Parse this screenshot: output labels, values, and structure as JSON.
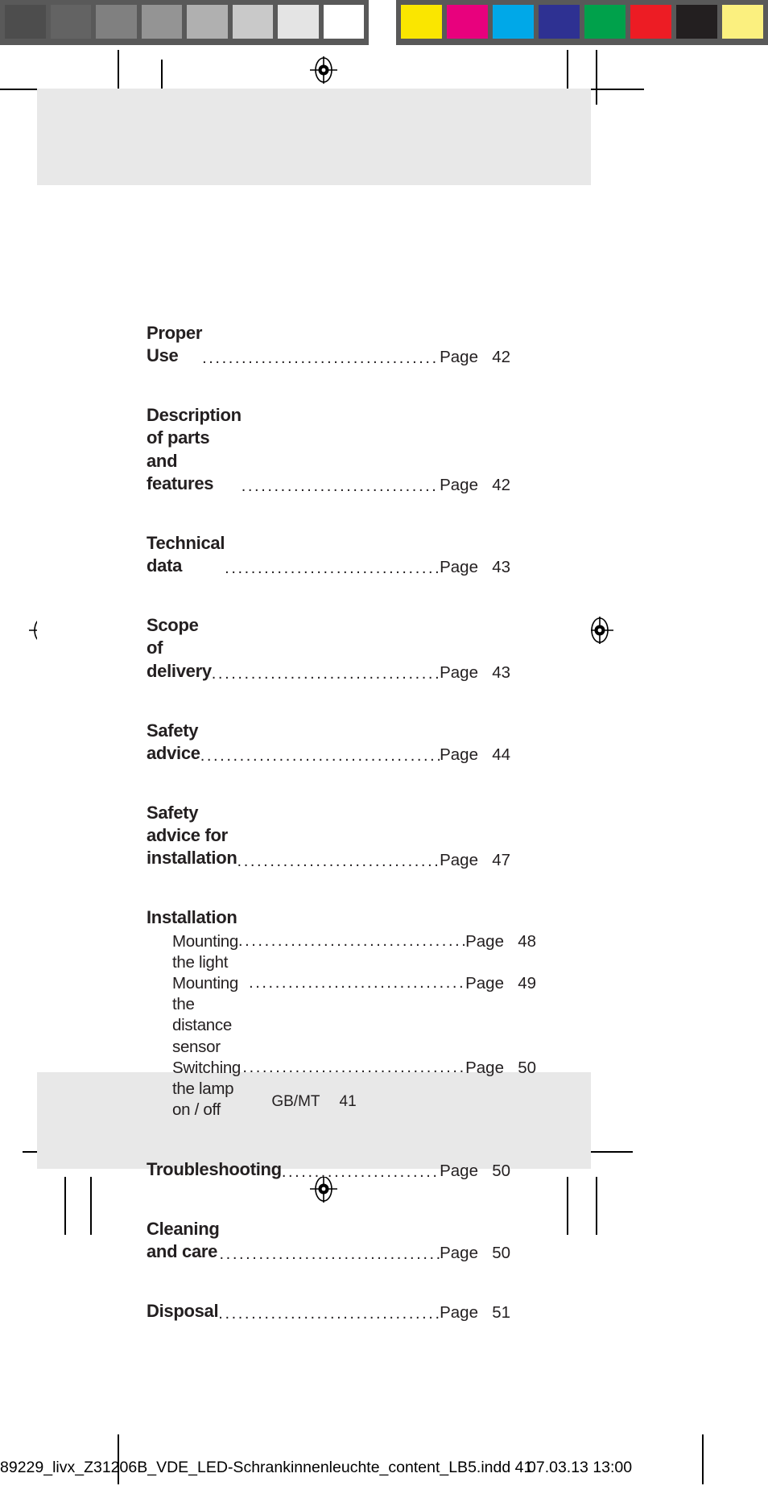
{
  "prepress": {
    "greyscale_strip": {
      "name": "greyscale-control-strip",
      "patches": [
        "#4d4d4d",
        "#636363",
        "#808080",
        "#949494",
        "#b0b0b0",
        "#c9c9c9",
        "#e4e4e4",
        "#ffffff"
      ]
    },
    "color_strip": {
      "name": "color-control-strip",
      "patches": [
        "#fae600",
        "#e8017d",
        "#00a8e8",
        "#2e3192",
        "#00a14b",
        "#ed1c24",
        "#231f20",
        "#fbf07f"
      ]
    },
    "strip_background": "#595959",
    "registration_marks": 3,
    "slug_line": {
      "filename": "89229_livx_Z31206B_VDE_LED-Schrankinnenleuchte_content_LB5.indd   41",
      "timestamp": "07.03.13   13:00"
    }
  },
  "page": {
    "background": "#ffffff",
    "band_color": "#e8e8e8",
    "footer": {
      "locale": "GB/MT",
      "folio": "41"
    }
  },
  "toc": {
    "page_label": "Page",
    "entries": [
      {
        "title": "Proper Use",
        "leader": true,
        "page_label": "Page",
        "page": "42",
        "level": 1,
        "lines": 1
      },
      {
        "title": "Description of parts and\nfeatures",
        "leader": true,
        "page_label": "Page",
        "page": "42",
        "level": 1,
        "lines": 2
      },
      {
        "title": "Technical data",
        "leader": true,
        "page_label": "Page",
        "page": "43",
        "level": 1,
        "lines": 1
      },
      {
        "title": "Scope of delivery",
        "leader": true,
        "page_label": "Page",
        "page": "43",
        "level": 1,
        "lines": 1
      },
      {
        "title": "Safety advice",
        "leader": true,
        "page_label": "Page",
        "page": "44",
        "level": 1,
        "lines": 1
      },
      {
        "title": "Safety advice for\ninstallation",
        "leader": true,
        "page_label": "Page",
        "page": "47",
        "level": 1,
        "lines": 2
      }
    ],
    "installation_group": {
      "heading": "Installation",
      "items": [
        {
          "title": "Mounting the light",
          "page_label": "Page",
          "page": "48"
        },
        {
          "title": "Mounting the distance sensor",
          "page_label": "Page",
          "page": "49"
        },
        {
          "title": "Switching the lamp on / off",
          "page_label": "Page",
          "page": "50"
        }
      ]
    },
    "entries_after": [
      {
        "title": "Troubleshooting",
        "leader": true,
        "page_label": "Page",
        "page": "50",
        "level": 1,
        "lines": 1
      },
      {
        "title": "Cleaning and care",
        "leader": true,
        "page_label": "Page",
        "page": "50",
        "level": 1,
        "lines": 1
      },
      {
        "title": "Disposal",
        "leader": true,
        "page_label": "Page",
        "page": "51",
        "level": 1,
        "lines": 1
      }
    ]
  }
}
